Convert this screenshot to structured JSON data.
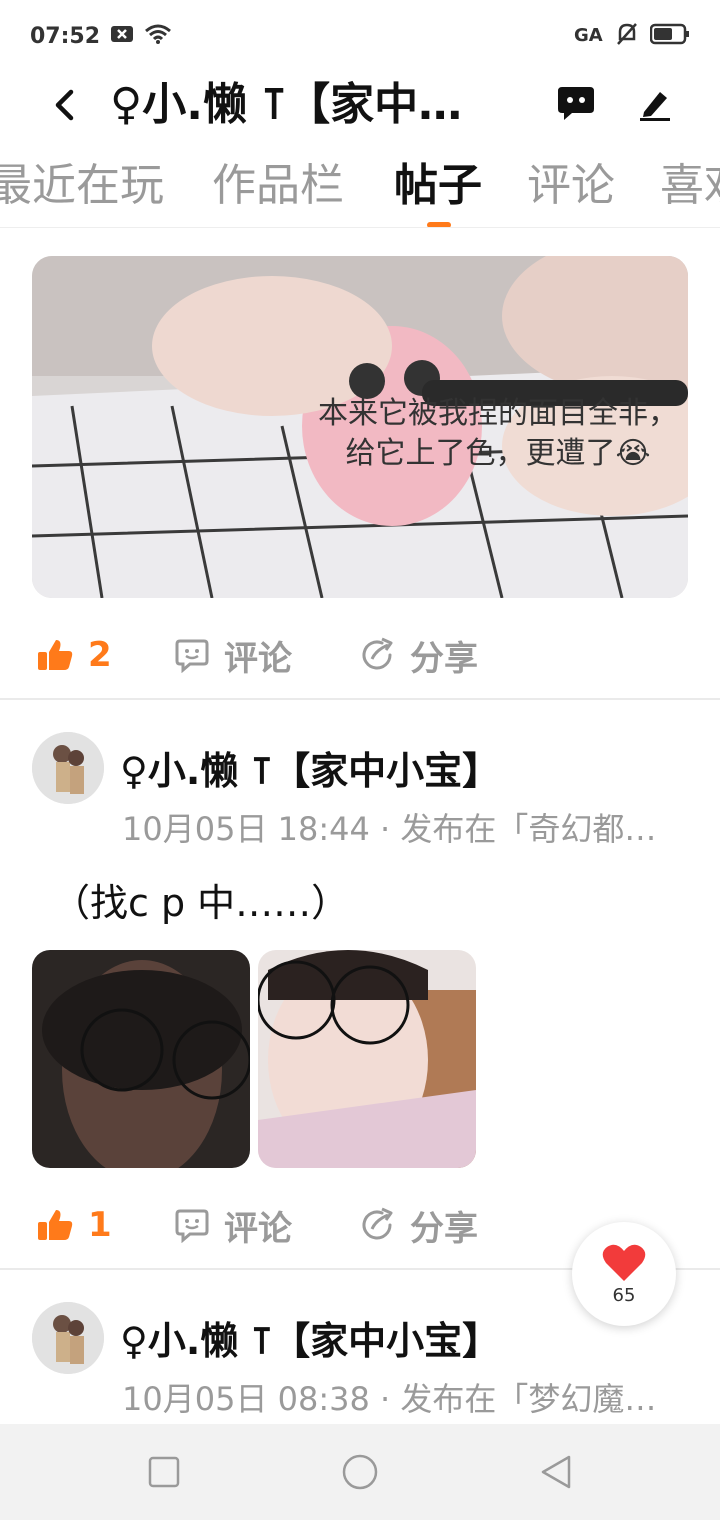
{
  "status_bar": {
    "time": "07:52",
    "icons_left": [
      "notification-x-icon",
      "wifi-icon"
    ],
    "icons_right": [
      "game-icon",
      "bell-off-icon",
      "battery-icon"
    ]
  },
  "header": {
    "title": "♀小.懒 ⊺【家中…",
    "back_icon": "back-arrow-icon",
    "chat_icon": "chat-bubble-icon",
    "edit_icon": "pencil-icon"
  },
  "tabs": [
    {
      "label": "最近在玩",
      "active": false
    },
    {
      "label": "作品栏",
      "active": false
    },
    {
      "label": "帖子",
      "active": true
    },
    {
      "label": "评论",
      "active": false
    },
    {
      "label": "喜欢",
      "active": false
    }
  ],
  "posts": [
    {
      "image_caption": "本来它被我捏的面目全非，给它上了色，更遭了😭",
      "likes": "2",
      "comment_label": "评论",
      "share_label": "分享"
    },
    {
      "author": "♀小.懒 ⊺【家中小宝】",
      "meta": "10月05日 18:44 · 发布在「奇幻都…",
      "text": "（找c p 中……）",
      "likes": "1",
      "comment_label": "评论",
      "share_label": "分享"
    },
    {
      "author": "♀小.懒 ⊺【家中小宝】",
      "meta": "10月05日 08:38 · 发布在「梦幻魔…"
    }
  ],
  "floating_like": {
    "count": "65",
    "icon": "heart-icon"
  },
  "colors": {
    "accent": "#ff7a1a",
    "muted": "#9a9a9a",
    "divider": "#eaeaea"
  }
}
